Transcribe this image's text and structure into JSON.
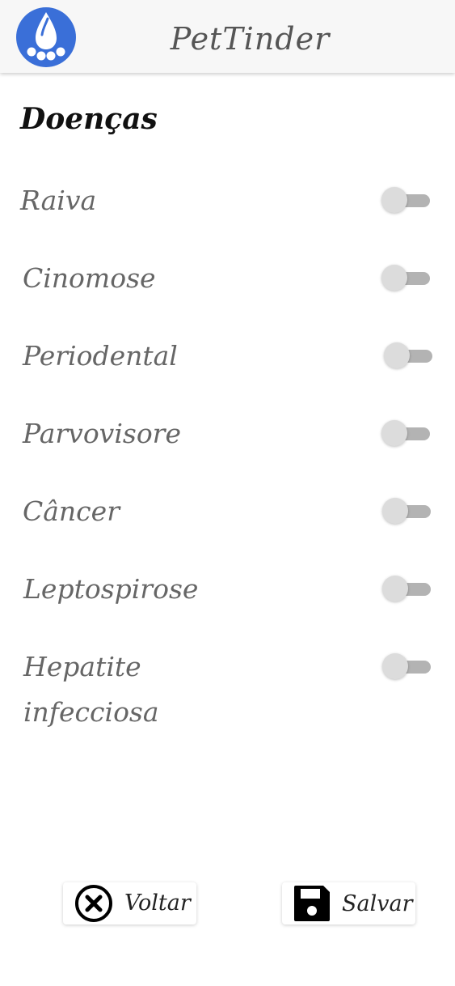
{
  "app": {
    "title": "PetTinder",
    "logo_icon": "paw-print-icon",
    "brand_color": "#3a6fd8"
  },
  "section": {
    "title": "Doenças"
  },
  "diseases": [
    {
      "label": "Raiva",
      "enabled": false
    },
    {
      "label": "Cinomose",
      "enabled": false
    },
    {
      "label": "Periodental",
      "enabled": false
    },
    {
      "label": "Parvovisore",
      "enabled": false
    },
    {
      "label": "Câncer",
      "enabled": false
    },
    {
      "label": "Leptospirose",
      "enabled": false
    },
    {
      "label": "Hepatite infecciosa",
      "enabled": false
    }
  ],
  "actions": {
    "back": {
      "label": "Voltar",
      "icon": "close-circle-icon"
    },
    "save": {
      "label": "Salvar",
      "icon": "floppy-disk-icon"
    }
  }
}
